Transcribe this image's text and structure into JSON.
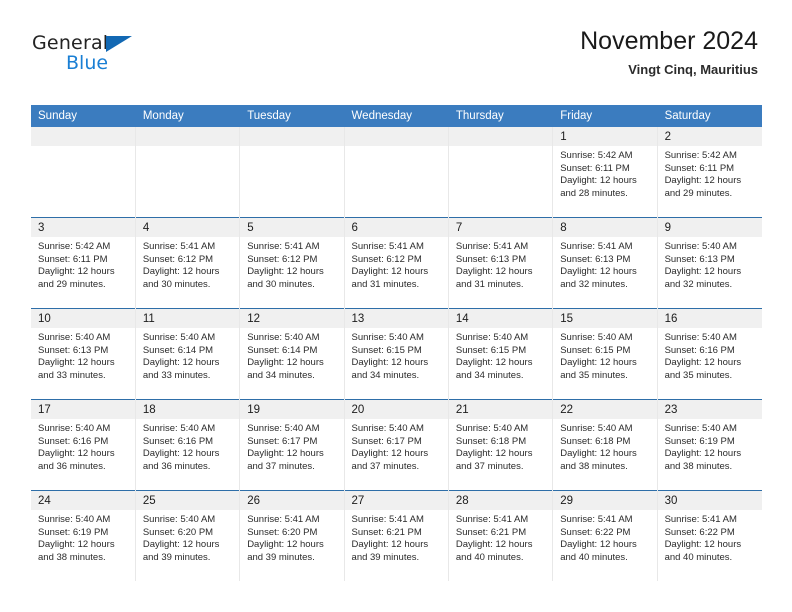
{
  "brand": {
    "name_part1": "General",
    "name_part2": "Blue",
    "triangle_color": "#1268b3",
    "blue_color": "#1a7fd4"
  },
  "header": {
    "title": "November 2024",
    "subtitle": "Vingt Cinq, Mauritius"
  },
  "theme": {
    "header_row_bg": "#3b7cbf",
    "header_row_text": "#ffffff",
    "day_band_bg": "#f0f0f0",
    "row_divider": "#2e6ea8"
  },
  "weekdays": [
    "Sunday",
    "Monday",
    "Tuesday",
    "Wednesday",
    "Thursday",
    "Friday",
    "Saturday"
  ],
  "weeks": [
    [
      {
        "day": "",
        "sunrise": "",
        "sunset": "",
        "daylight_line1": "",
        "daylight_line2": ""
      },
      {
        "day": "",
        "sunrise": "",
        "sunset": "",
        "daylight_line1": "",
        "daylight_line2": ""
      },
      {
        "day": "",
        "sunrise": "",
        "sunset": "",
        "daylight_line1": "",
        "daylight_line2": ""
      },
      {
        "day": "",
        "sunrise": "",
        "sunset": "",
        "daylight_line1": "",
        "daylight_line2": ""
      },
      {
        "day": "",
        "sunrise": "",
        "sunset": "",
        "daylight_line1": "",
        "daylight_line2": ""
      },
      {
        "day": "1",
        "sunrise": "Sunrise: 5:42 AM",
        "sunset": "Sunset: 6:11 PM",
        "daylight_line1": "Daylight: 12 hours",
        "daylight_line2": "and 28 minutes."
      },
      {
        "day": "2",
        "sunrise": "Sunrise: 5:42 AM",
        "sunset": "Sunset: 6:11 PM",
        "daylight_line1": "Daylight: 12 hours",
        "daylight_line2": "and 29 minutes."
      }
    ],
    [
      {
        "day": "3",
        "sunrise": "Sunrise: 5:42 AM",
        "sunset": "Sunset: 6:11 PM",
        "daylight_line1": "Daylight: 12 hours",
        "daylight_line2": "and 29 minutes."
      },
      {
        "day": "4",
        "sunrise": "Sunrise: 5:41 AM",
        "sunset": "Sunset: 6:12 PM",
        "daylight_line1": "Daylight: 12 hours",
        "daylight_line2": "and 30 minutes."
      },
      {
        "day": "5",
        "sunrise": "Sunrise: 5:41 AM",
        "sunset": "Sunset: 6:12 PM",
        "daylight_line1": "Daylight: 12 hours",
        "daylight_line2": "and 30 minutes."
      },
      {
        "day": "6",
        "sunrise": "Sunrise: 5:41 AM",
        "sunset": "Sunset: 6:12 PM",
        "daylight_line1": "Daylight: 12 hours",
        "daylight_line2": "and 31 minutes."
      },
      {
        "day": "7",
        "sunrise": "Sunrise: 5:41 AM",
        "sunset": "Sunset: 6:13 PM",
        "daylight_line1": "Daylight: 12 hours",
        "daylight_line2": "and 31 minutes."
      },
      {
        "day": "8",
        "sunrise": "Sunrise: 5:41 AM",
        "sunset": "Sunset: 6:13 PM",
        "daylight_line1": "Daylight: 12 hours",
        "daylight_line2": "and 32 minutes."
      },
      {
        "day": "9",
        "sunrise": "Sunrise: 5:40 AM",
        "sunset": "Sunset: 6:13 PM",
        "daylight_line1": "Daylight: 12 hours",
        "daylight_line2": "and 32 minutes."
      }
    ],
    [
      {
        "day": "10",
        "sunrise": "Sunrise: 5:40 AM",
        "sunset": "Sunset: 6:13 PM",
        "daylight_line1": "Daylight: 12 hours",
        "daylight_line2": "and 33 minutes."
      },
      {
        "day": "11",
        "sunrise": "Sunrise: 5:40 AM",
        "sunset": "Sunset: 6:14 PM",
        "daylight_line1": "Daylight: 12 hours",
        "daylight_line2": "and 33 minutes."
      },
      {
        "day": "12",
        "sunrise": "Sunrise: 5:40 AM",
        "sunset": "Sunset: 6:14 PM",
        "daylight_line1": "Daylight: 12 hours",
        "daylight_line2": "and 34 minutes."
      },
      {
        "day": "13",
        "sunrise": "Sunrise: 5:40 AM",
        "sunset": "Sunset: 6:15 PM",
        "daylight_line1": "Daylight: 12 hours",
        "daylight_line2": "and 34 minutes."
      },
      {
        "day": "14",
        "sunrise": "Sunrise: 5:40 AM",
        "sunset": "Sunset: 6:15 PM",
        "daylight_line1": "Daylight: 12 hours",
        "daylight_line2": "and 34 minutes."
      },
      {
        "day": "15",
        "sunrise": "Sunrise: 5:40 AM",
        "sunset": "Sunset: 6:15 PM",
        "daylight_line1": "Daylight: 12 hours",
        "daylight_line2": "and 35 minutes."
      },
      {
        "day": "16",
        "sunrise": "Sunrise: 5:40 AM",
        "sunset": "Sunset: 6:16 PM",
        "daylight_line1": "Daylight: 12 hours",
        "daylight_line2": "and 35 minutes."
      }
    ],
    [
      {
        "day": "17",
        "sunrise": "Sunrise: 5:40 AM",
        "sunset": "Sunset: 6:16 PM",
        "daylight_line1": "Daylight: 12 hours",
        "daylight_line2": "and 36 minutes."
      },
      {
        "day": "18",
        "sunrise": "Sunrise: 5:40 AM",
        "sunset": "Sunset: 6:16 PM",
        "daylight_line1": "Daylight: 12 hours",
        "daylight_line2": "and 36 minutes."
      },
      {
        "day": "19",
        "sunrise": "Sunrise: 5:40 AM",
        "sunset": "Sunset: 6:17 PM",
        "daylight_line1": "Daylight: 12 hours",
        "daylight_line2": "and 37 minutes."
      },
      {
        "day": "20",
        "sunrise": "Sunrise: 5:40 AM",
        "sunset": "Sunset: 6:17 PM",
        "daylight_line1": "Daylight: 12 hours",
        "daylight_line2": "and 37 minutes."
      },
      {
        "day": "21",
        "sunrise": "Sunrise: 5:40 AM",
        "sunset": "Sunset: 6:18 PM",
        "daylight_line1": "Daylight: 12 hours",
        "daylight_line2": "and 37 minutes."
      },
      {
        "day": "22",
        "sunrise": "Sunrise: 5:40 AM",
        "sunset": "Sunset: 6:18 PM",
        "daylight_line1": "Daylight: 12 hours",
        "daylight_line2": "and 38 minutes."
      },
      {
        "day": "23",
        "sunrise": "Sunrise: 5:40 AM",
        "sunset": "Sunset: 6:19 PM",
        "daylight_line1": "Daylight: 12 hours",
        "daylight_line2": "and 38 minutes."
      }
    ],
    [
      {
        "day": "24",
        "sunrise": "Sunrise: 5:40 AM",
        "sunset": "Sunset: 6:19 PM",
        "daylight_line1": "Daylight: 12 hours",
        "daylight_line2": "and 38 minutes."
      },
      {
        "day": "25",
        "sunrise": "Sunrise: 5:40 AM",
        "sunset": "Sunset: 6:20 PM",
        "daylight_line1": "Daylight: 12 hours",
        "daylight_line2": "and 39 minutes."
      },
      {
        "day": "26",
        "sunrise": "Sunrise: 5:41 AM",
        "sunset": "Sunset: 6:20 PM",
        "daylight_line1": "Daylight: 12 hours",
        "daylight_line2": "and 39 minutes."
      },
      {
        "day": "27",
        "sunrise": "Sunrise: 5:41 AM",
        "sunset": "Sunset: 6:21 PM",
        "daylight_line1": "Daylight: 12 hours",
        "daylight_line2": "and 39 minutes."
      },
      {
        "day": "28",
        "sunrise": "Sunrise: 5:41 AM",
        "sunset": "Sunset: 6:21 PM",
        "daylight_line1": "Daylight: 12 hours",
        "daylight_line2": "and 40 minutes."
      },
      {
        "day": "29",
        "sunrise": "Sunrise: 5:41 AM",
        "sunset": "Sunset: 6:22 PM",
        "daylight_line1": "Daylight: 12 hours",
        "daylight_line2": "and 40 minutes."
      },
      {
        "day": "30",
        "sunrise": "Sunrise: 5:41 AM",
        "sunset": "Sunset: 6:22 PM",
        "daylight_line1": "Daylight: 12 hours",
        "daylight_line2": "and 40 minutes."
      }
    ]
  ]
}
